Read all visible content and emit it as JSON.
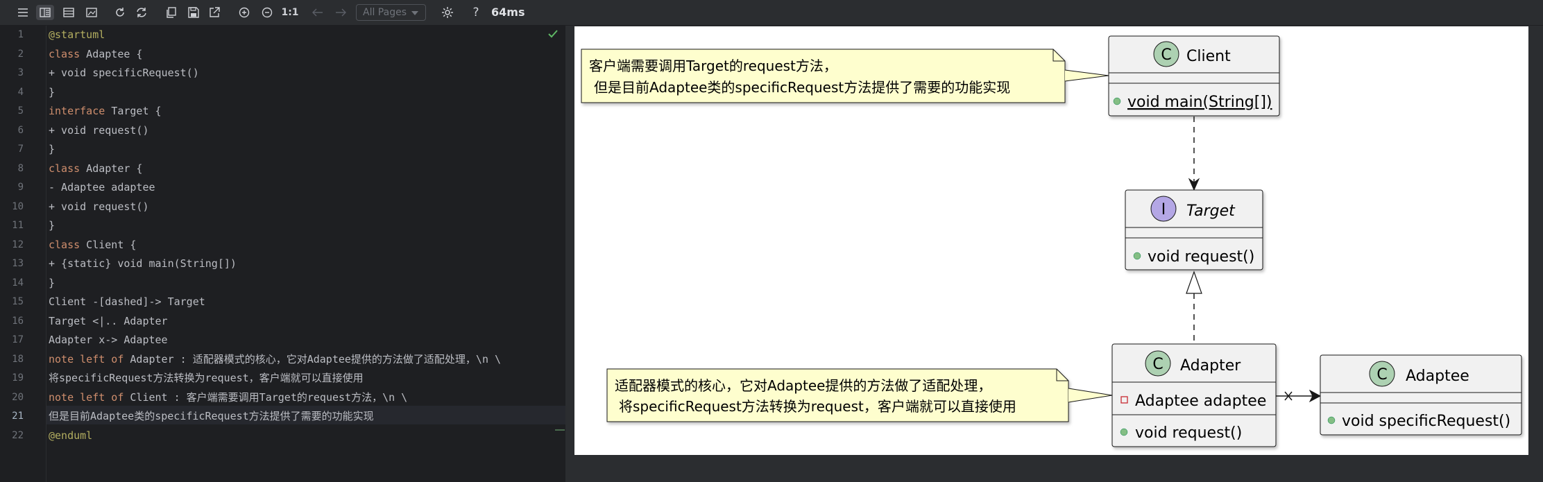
{
  "toolbar": {
    "page_select": "All Pages",
    "zoom_reset": "1:1",
    "timing": "64ms"
  },
  "editor": {
    "line_numbers": [
      "1",
      "2",
      "3",
      "4",
      "5",
      "6",
      "7",
      "8",
      "9",
      "10",
      "11",
      "12",
      "13",
      "14",
      "15",
      "16",
      "17",
      "18",
      "19",
      "20",
      "21",
      "22"
    ],
    "current_line": 21
  },
  "diagram": {
    "note_client_line1": "客户端需要调用Target的request方法，",
    "note_client_line2": "但是目前Adaptee类的specificRequest方法提供了需要的功能实现",
    "client_name": "Client",
    "client_method": "void main(String[])",
    "target_name": "Target",
    "target_method": "void request()",
    "adapter_name": "Adapter",
    "adapter_field": "Adaptee adaptee",
    "adapter_method": "void request()",
    "adaptee_name": "Adaptee",
    "adaptee_method": "void specificRequest()",
    "note_adapter_line1": "适配器模式的核心，它对Adaptee提供的方法做了适配处理，",
    "note_adapter_line2": "将specificRequest方法转换为request，客户端就可以直接使用",
    "stereo_class": "C",
    "stereo_interface": "I"
  },
  "colors": {
    "note_fill": "#fefece",
    "class_fill": "#f1f1f1",
    "class_circle": "#add1b2",
    "interface_circle": "#b4a7e5",
    "public_dot": "#84be84",
    "private_square": "#c82930"
  }
}
